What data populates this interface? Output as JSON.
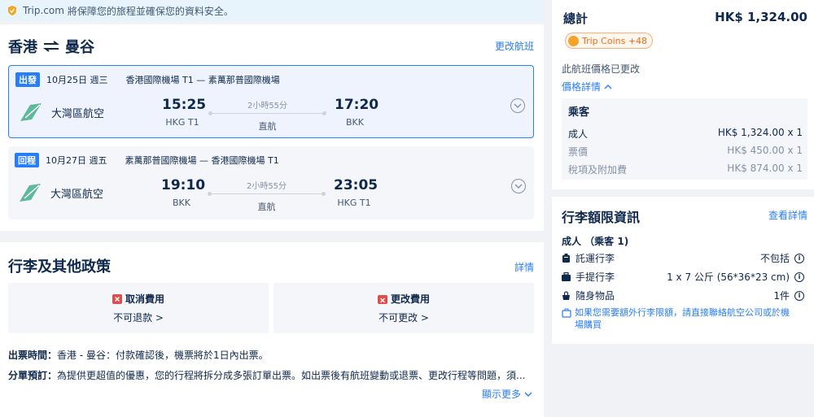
{
  "banner": {
    "brand": "Trip.com",
    "text": "將保障您的旅程並確保您的資料安全。"
  },
  "route": {
    "origin": "香港",
    "destination": "曼谷",
    "change_label": "更改航班"
  },
  "segments": [
    {
      "tag": "出發",
      "date": "10月25日 週三",
      "airports": "香港國際機場 T1 — 素萬那普國際機場",
      "airline": "大灣區航空",
      "dep_time": "15:25",
      "dep_code": "HKG T1",
      "duration": "2小時55分",
      "stop": "直航",
      "arr_time": "17:20",
      "arr_code": "BKK"
    },
    {
      "tag": "回程",
      "date": "10月27日 週五",
      "airports": "素萬那普國際機場 — 香港國際機場 T1",
      "airline": "大灣區航空",
      "dep_time": "19:10",
      "dep_code": "BKK",
      "duration": "2小時55分",
      "stop": "直航",
      "arr_time": "23:05",
      "arr_code": "HKG T1"
    }
  ],
  "policy": {
    "title": "行李及其他政策",
    "detail_label": "詳情",
    "cancel": {
      "title": "取消費用",
      "sub": "不可退款 >"
    },
    "change": {
      "title": "更改費用",
      "sub": "不可更改 >"
    },
    "ticketing_label": "出票時間：",
    "ticketing_text": "香港 - 曼谷：付款確認後，機票將於1日內出票。",
    "split_label": "分單預訂：",
    "split_text": "為提供更超值的優惠，您的行程將拆分成多張訂單出票。如出票後有航班變動或退票、更改行程等問題，須...",
    "show_more": "顯示更多"
  },
  "price": {
    "total_label": "總計",
    "total_value": "HK$ 1,324.00",
    "coins": "Trip Coins +48",
    "changed_note": "此航班價格已更改",
    "detail_label": "價格詳情",
    "pax_heading": "乘客",
    "rows": [
      {
        "label": "成人",
        "value": "HK$ 1,324.00 x 1"
      },
      {
        "label": "票價",
        "value": "HK$ 450.00 x 1"
      },
      {
        "label": "稅項及附加費",
        "value": "HK$ 874.00 x 1"
      }
    ]
  },
  "baggage": {
    "title": "行李額限資訊",
    "detail_label": "查看詳情",
    "pax": "成人 （乘客 1)",
    "rows": [
      {
        "name": "託運行李",
        "value": "不包括"
      },
      {
        "name": "手提行李",
        "value": "1 x 7 公斤 (56*36*23 cm)"
      },
      {
        "name": "隨身物品",
        "value": "1件"
      }
    ],
    "note": "如果您需要額外行李限額，請直接聯絡航空公司或於機場購買"
  },
  "colors": {
    "accent": "#287dfa",
    "text": "#0f294d",
    "coin": "#f26e1f",
    "airline": "#5fb89a"
  }
}
